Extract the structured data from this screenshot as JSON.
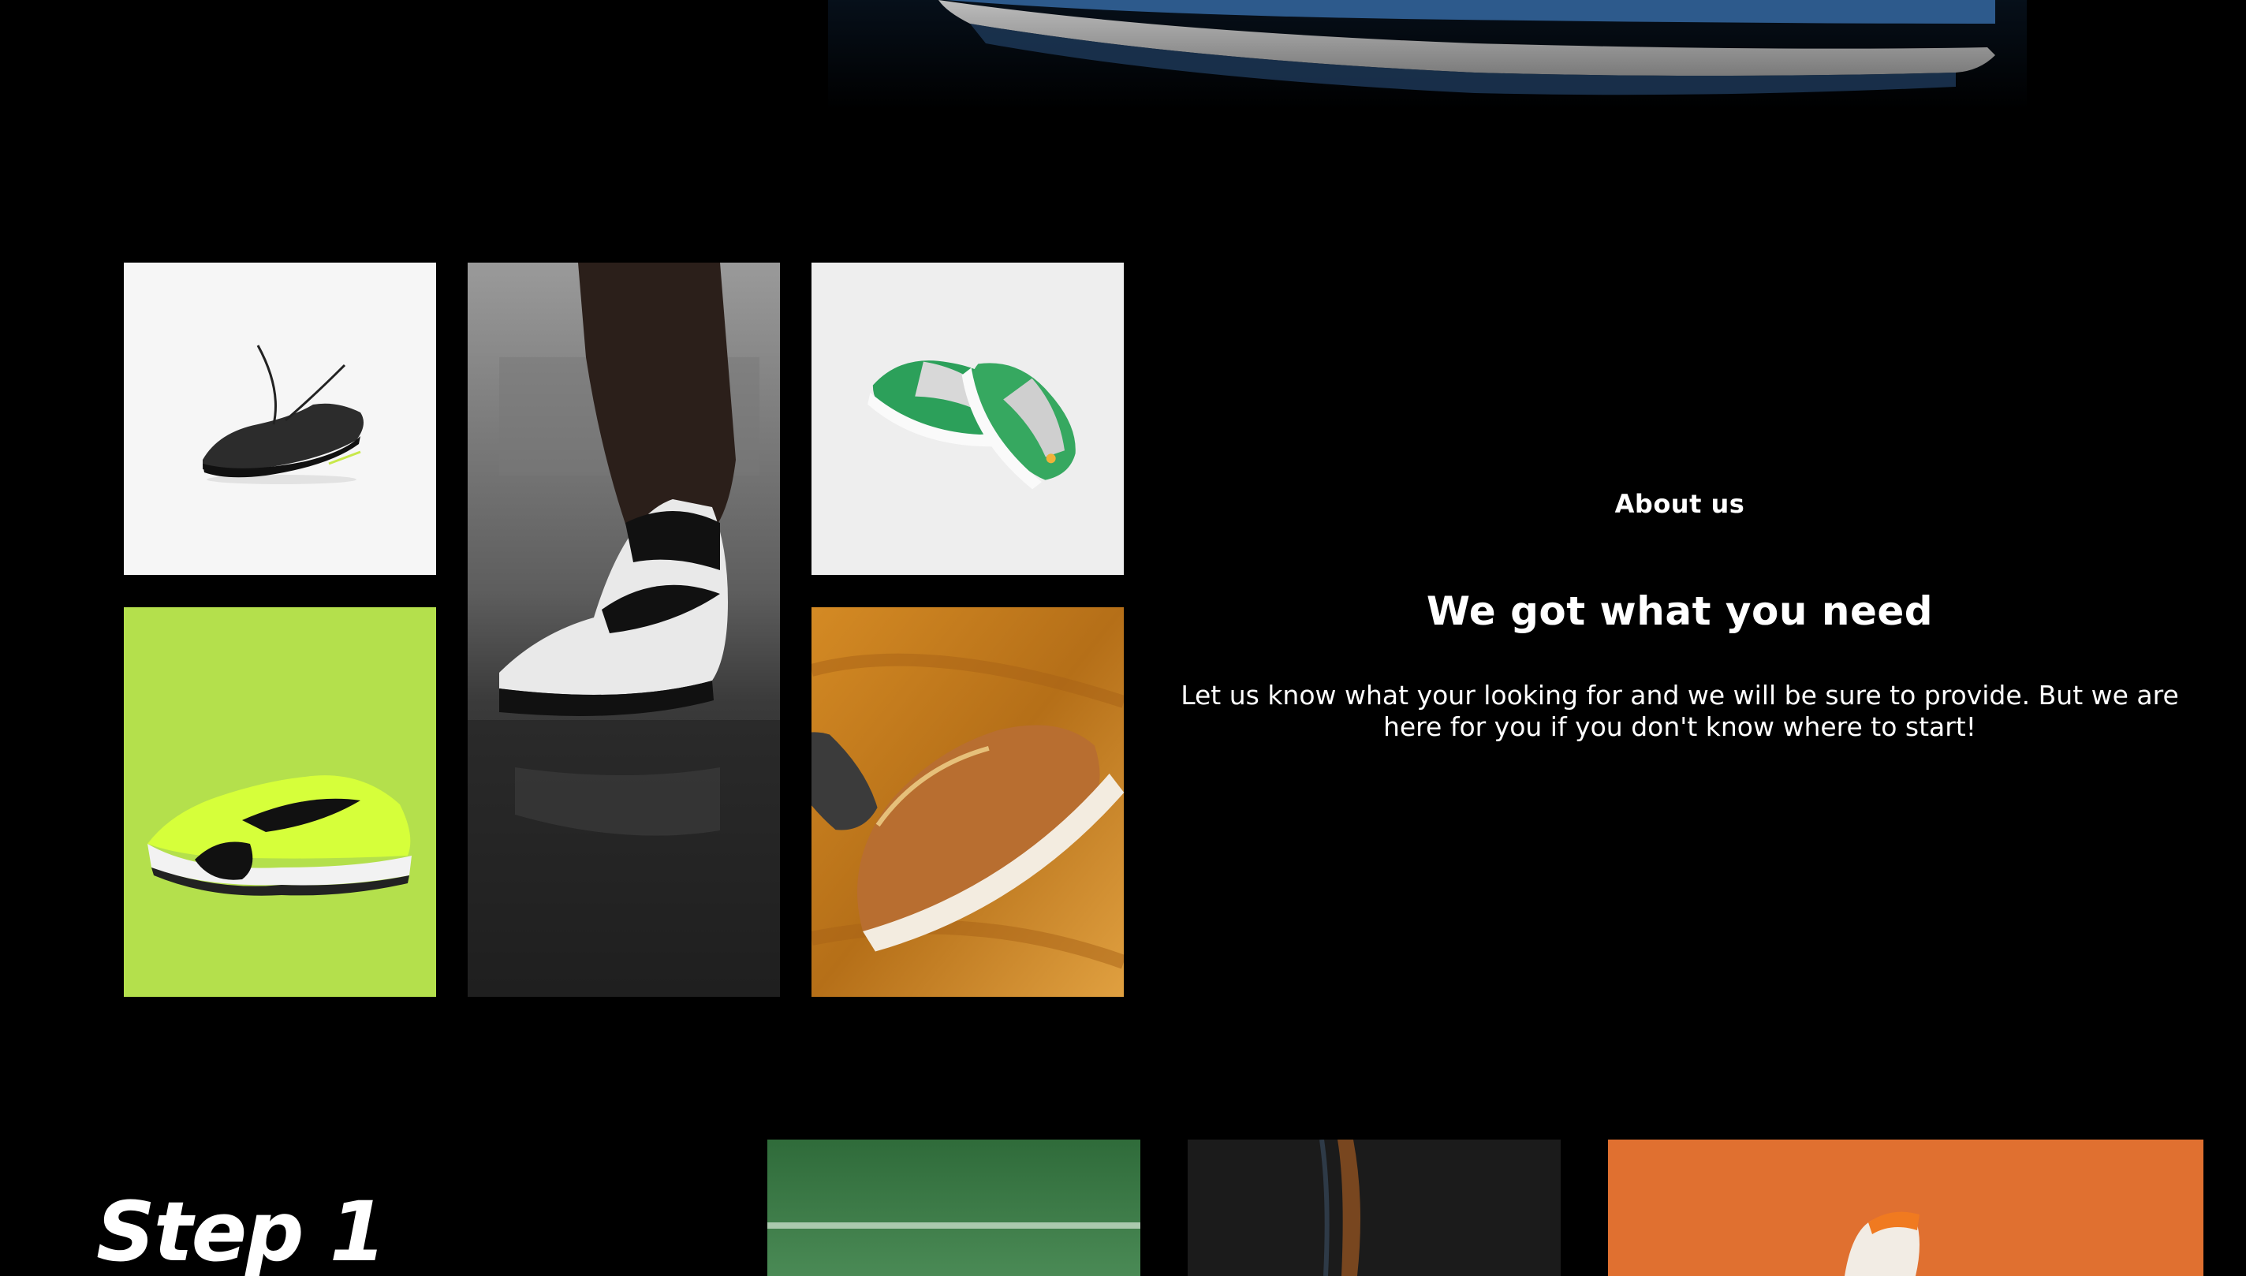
{
  "about": {
    "eyebrow": "About us",
    "title": "We got what you need",
    "body": "Let us know what your looking for and we will be sure to provide. But we are here for you if you don't know where to start!"
  },
  "step": {
    "title": "Step 1"
  },
  "colors": {
    "background": "#000000",
    "text": "#ffffff",
    "volt": "#b4e04c",
    "tan": "#cf8a2a",
    "field_green": "#3a7a45",
    "orange": "#e07030"
  },
  "images": {
    "hero": "blue-sneaker-sole-photo",
    "gallery": [
      "black-runner-shoe-photo",
      "street-air-jordan-photo",
      "green-air-jordan-pair-photo",
      "volt-training-shoe-photo",
      "tan-air-force-photo"
    ],
    "steps": [
      "turf-field-photo",
      "dark-flame-photo",
      "orange-sneaker-photo"
    ]
  }
}
